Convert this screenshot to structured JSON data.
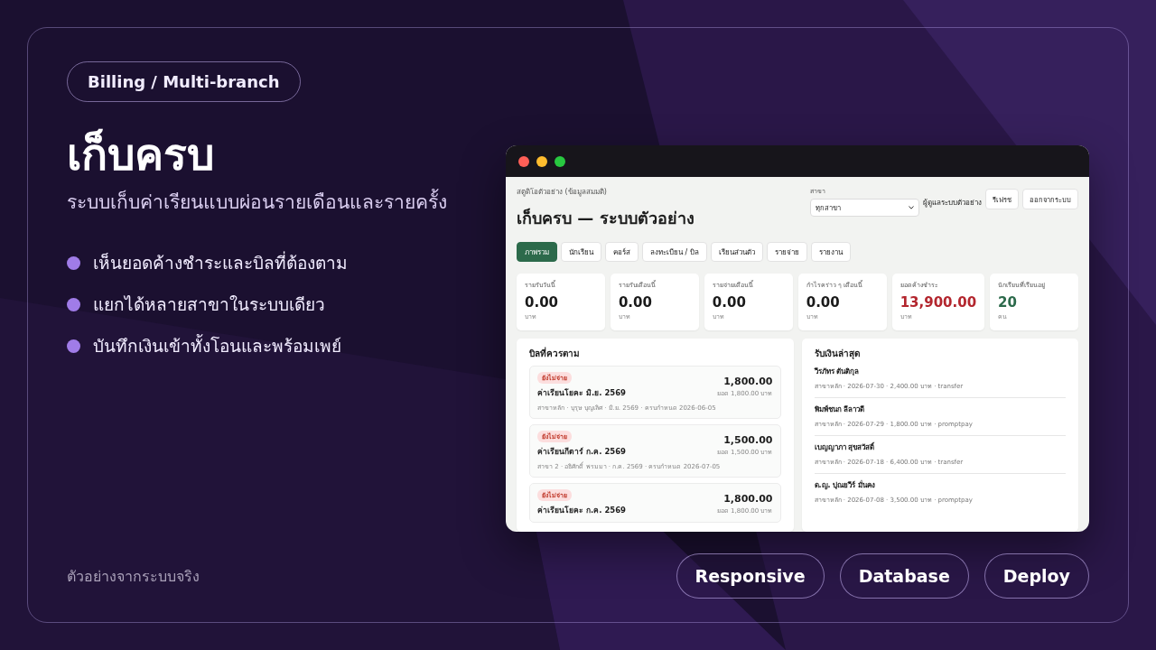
{
  "tag": "Billing / Multi-branch",
  "hero": {
    "title": "เก็บครบ",
    "subtitle": "ระบบเก็บค่าเรียนแบบผ่อนรายเดือนและรายครั้ง"
  },
  "features": [
    "เห็นยอดค้างชำระและบิลที่ต้องตาม",
    "แยกได้หลายสาขาในระบบเดียว",
    "บันทึกเงินเข้าทั้งโอนและพร้อมเพย์"
  ],
  "app_window": {
    "window_controls": [
      {
        "color": "#ff5f57"
      },
      {
        "color": "#febc2e"
      },
      {
        "color": "#28c840"
      }
    ],
    "header": {
      "studio": "สตูดิโอตัวอย่าง (ข้อมูลสมมติ)",
      "title": "เก็บครบ — ระบบตัวอย่าง",
      "branch_label": "สาขา",
      "branch_value": "ทุกสาขา",
      "user": "ผู้ดูแลระบบตัวอย่าง",
      "buttons": [
        "รีเฟรช",
        "ออกจากระบบ"
      ]
    },
    "tabs": [
      {
        "label": "ภาพรวม",
        "selected": true
      },
      {
        "label": "นักเรียน",
        "selected": false
      },
      {
        "label": "คอร์ส",
        "selected": false
      },
      {
        "label": "ลงทะเบียน / บิล",
        "selected": false
      },
      {
        "label": "เรียนส่วนตัว",
        "selected": false
      },
      {
        "label": "รายจ่าย",
        "selected": false
      },
      {
        "label": "รายงาน",
        "selected": false
      }
    ],
    "stats": [
      {
        "label": "รายรับวันนี้",
        "value": "0.00",
        "unit": "บาท",
        "color": "#1a1a1a"
      },
      {
        "label": "รายรับเดือนนี้",
        "value": "0.00",
        "unit": "บาท",
        "color": "#1a1a1a"
      },
      {
        "label": "รายจ่ายเดือนนี้",
        "value": "0.00",
        "unit": "บาท",
        "color": "#1a1a1a"
      },
      {
        "label": "กำไรคร่าว ๆ เดือนนี้",
        "value": "0.00",
        "unit": "บาท",
        "color": "#1a1a1a"
      },
      {
        "label": "ยอดค้างชำระ",
        "value": "13,900.00",
        "unit": "บาท",
        "color": "#b3262e"
      },
      {
        "label": "นักเรียนที่เรียนอยู่",
        "value": "20",
        "unit": "คน",
        "color": "#2c6a4b"
      }
    ],
    "bills": {
      "title": "บิลที่ควรตาม",
      "items": [
        {
          "status": "ยังไม่จ่าย",
          "title": "ค่าเรียนโยคะ มิ.ย. 2569",
          "meta": "สาขาหลัก · บุรุษ บุญเลิศ · มิ.ย. 2569 · ครบกำหนด 2026-06-05",
          "amount": "1,800.00",
          "total": "ยอด 1,800.00 บาท"
        },
        {
          "status": "ยังไม่จ่าย",
          "title": "ค่าเรียนกีตาร์ ก.ค. 2569",
          "meta": "สาขา 2 · อธิศักดิ์ พรมมา · ก.ค. 2569 · ครบกำหนด 2026-07-05",
          "amount": "1,500.00",
          "total": "ยอด 1,500.00 บาท"
        },
        {
          "status": "ยังไม่จ่าย",
          "title": "ค่าเรียนโยคะ ก.ค. 2569",
          "amount": "1,800.00",
          "total": "ยอด 1,800.00 บาท"
        }
      ]
    },
    "receipts": {
      "title": "รับเงินล่าสุด",
      "items": [
        {
          "name": "วีรภัทร ตันติกุล",
          "meta": "สาขาหลัก · 2026-07-30 · 2,400.00 บาท · transfer"
        },
        {
          "name": "พิมพ์ชนก ลีลาวดี",
          "meta": "สาขาหลัก · 2026-07-29 · 1,800.00 บาท · promptpay"
        },
        {
          "name": "เบญญาภา สุขสวัสดิ์",
          "meta": "สาขาหลัก · 2026-07-18 · 6,400.00 บาท · transfer"
        },
        {
          "name": "ด.ญ. ปุณยวีร์ มั่นคง",
          "meta": "สาขาหลัก · 2026-07-08 · 3,500.00 บาท · promptpay"
        }
      ]
    }
  },
  "footer": {
    "note": "ตัวอย่างจากระบบจริง",
    "pills": [
      "Responsive",
      "Database",
      "Deploy"
    ]
  }
}
